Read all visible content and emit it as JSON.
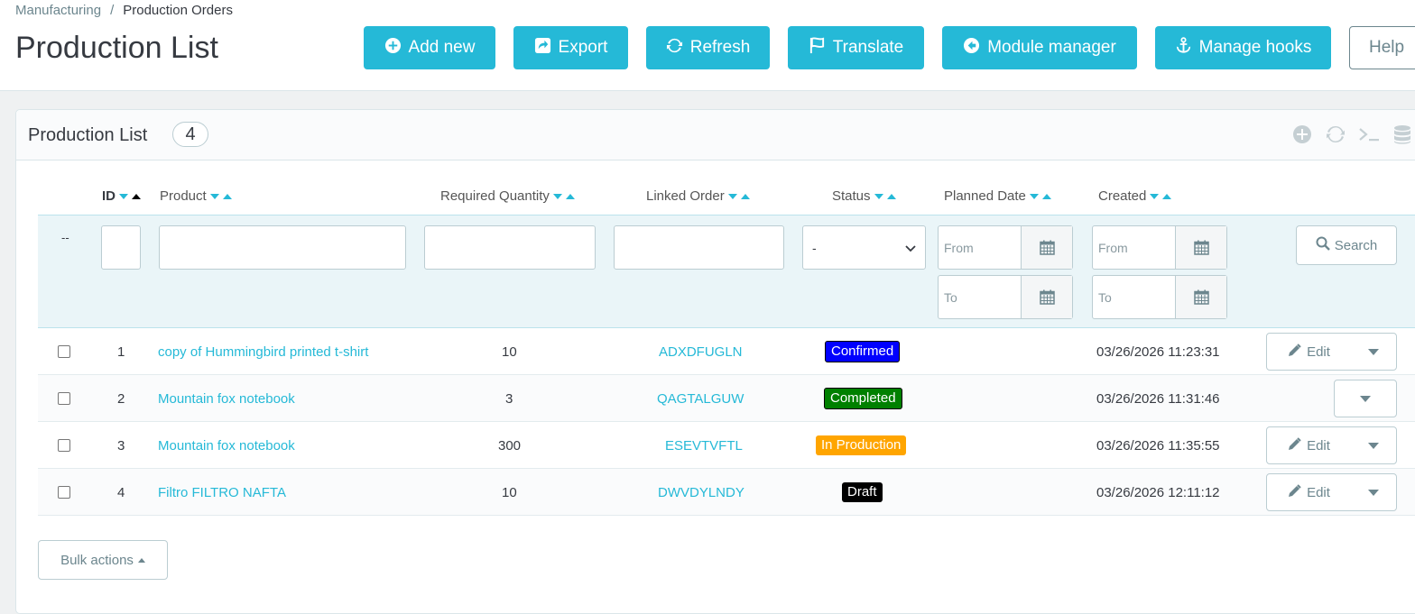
{
  "breadcrumb": {
    "parent": "Manufacturing",
    "separator": "/",
    "current": "Production Orders"
  },
  "header": {
    "title": "Production List"
  },
  "toolbar": {
    "buttons": [
      {
        "label": "Add new",
        "icon": "plus-circle-icon"
      },
      {
        "label": "Export",
        "icon": "export-icon"
      },
      {
        "label": "Refresh",
        "icon": "refresh-icon"
      },
      {
        "label": "Translate",
        "icon": "flag-icon"
      },
      {
        "label": "Module manager",
        "icon": "arrow-left-circle-icon"
      },
      {
        "label": "Manage hooks",
        "icon": "anchor-icon"
      }
    ],
    "help_label": "Help"
  },
  "panel": {
    "title": "Production List",
    "count": "4",
    "icons": [
      "add-circle-icon",
      "refresh-icon",
      "terminal-icon",
      "database-icon"
    ]
  },
  "table": {
    "columns": [
      {
        "label": "ID"
      },
      {
        "label": "Product"
      },
      {
        "label": "Required Quantity"
      },
      {
        "label": "Linked Order"
      },
      {
        "label": "Status"
      },
      {
        "label": "Planned Date"
      },
      {
        "label": "Created"
      }
    ],
    "filters": {
      "reset": "--",
      "status_selected": "-",
      "from_placeholder": "From",
      "to_placeholder": "To",
      "search_label": "Search"
    },
    "rows": [
      {
        "id": "1",
        "product": "copy of Hummingbird printed t-shirt",
        "qty": "10",
        "order": "ADXDFUGLN",
        "status": "Confirmed",
        "status_color": "#0000ff",
        "created": "03/26/2026 11:23:31",
        "edit": "Edit",
        "has_edit": true
      },
      {
        "id": "2",
        "product": "Mountain fox notebook",
        "qty": "3",
        "order": "QAGTALGUW",
        "status": "Completed",
        "status_color": "#008000",
        "created": "03/26/2026 11:31:46",
        "edit": "",
        "has_edit": false
      },
      {
        "id": "3",
        "product": "Mountain fox notebook",
        "qty": "300",
        "order": "ESEVTVFTL",
        "status": "In Production",
        "status_color": "#ffa500",
        "created": "03/26/2026 11:35:55",
        "edit": "Edit",
        "has_edit": true
      },
      {
        "id": "4",
        "product": "Filtro FILTRO NAFTA",
        "qty": "10",
        "order": "DWVDYLNDY",
        "status": "Draft",
        "status_color": "#000000",
        "created": "03/26/2026 12:11:12",
        "edit": "Edit",
        "has_edit": true
      }
    ],
    "bulk_label": "Bulk actions"
  },
  "colors": {
    "accent": "#25b9d7",
    "text": "#363a41",
    "muted": "#6c868e"
  }
}
